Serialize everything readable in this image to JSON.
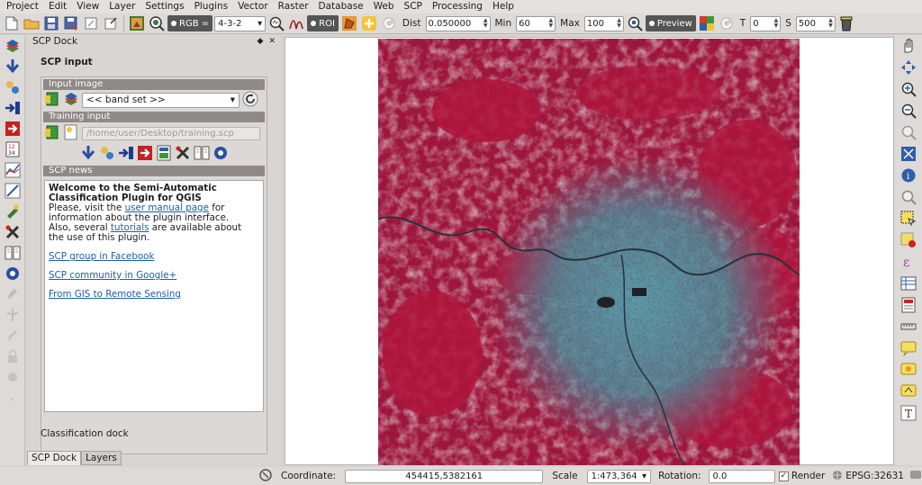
{
  "menubar": {
    "items": [
      "Project",
      "Edit",
      "View",
      "Layer",
      "Settings",
      "Plugins",
      "Vector",
      "Raster",
      "Database",
      "Web",
      "SCP",
      "Processing",
      "Help"
    ]
  },
  "toolbar": {
    "rgb_label": "RGB =",
    "rgb_value": "4-3-2",
    "roi_label": "ROI",
    "dist_label": "Dist",
    "dist_value": "0.050000",
    "min_label": "Min",
    "min_value": "60",
    "max_label": "Max",
    "max_value": "100",
    "preview_label": "Preview",
    "t_label": "T",
    "t_value": "0",
    "s_label": "S",
    "s_value": "500"
  },
  "dock": {
    "title": "SCP Dock",
    "panel_title": "SCP input",
    "input_image_header": "Input image",
    "band_set_value": "<< band set >>",
    "training_input_header": "Training input",
    "training_path": "/home/user/Desktop/training.scp",
    "news_header": "SCP news",
    "news": {
      "heading": "Welcome to the Semi-Automatic Classification Plugin for QGIS",
      "visit_prefix": "Please, visit the ",
      "manual_link": "user manual page",
      "visit_suffix": " for information about the plugin interface.",
      "tutorials_prefix": "Also, several ",
      "tutorials_link": "tutorials",
      "tutorials_suffix": " are available about the use of this plugin.",
      "link_facebook": "SCP group in Facebook",
      "link_google": "SCP community in Google+",
      "link_gis": "From GIS to Remote Sensing"
    },
    "classification_dock": "Classification dock",
    "tabs": [
      "SCP Dock",
      "Layers"
    ]
  },
  "statusbar": {
    "coordinate_label": "Coordinate:",
    "coordinate_value": "454415,5382161",
    "scale_label": "Scale",
    "scale_value": "1:473,364",
    "rotation_label": "Rotation:",
    "rotation_value": "0.0",
    "render_label": "Render",
    "crs_label": "EPSG:32631"
  },
  "colors": {
    "vegetation_red": "#b5123a",
    "urban_cyan": "#5fbcc4",
    "link_blue": "#1c5fa5"
  }
}
